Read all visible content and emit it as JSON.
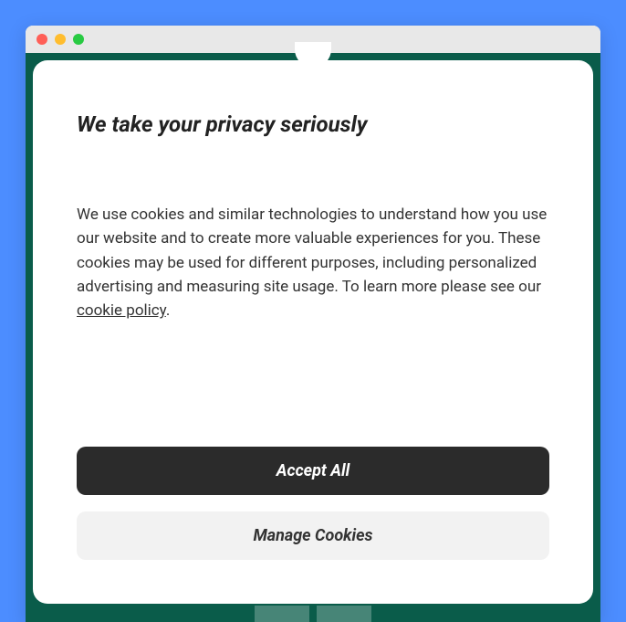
{
  "modal": {
    "title": "We take your privacy seriously",
    "body_pre": "We use cookies and similar technologies to understand how you use our website and to create more valuable experiences for you. These cookies may be used for different purposes, including personalized advertising and measuring site usage. To learn more please see our ",
    "link_text": "cookie policy",
    "body_post": ".",
    "accept_label": "Accept All",
    "manage_label": "Manage Cookies"
  }
}
